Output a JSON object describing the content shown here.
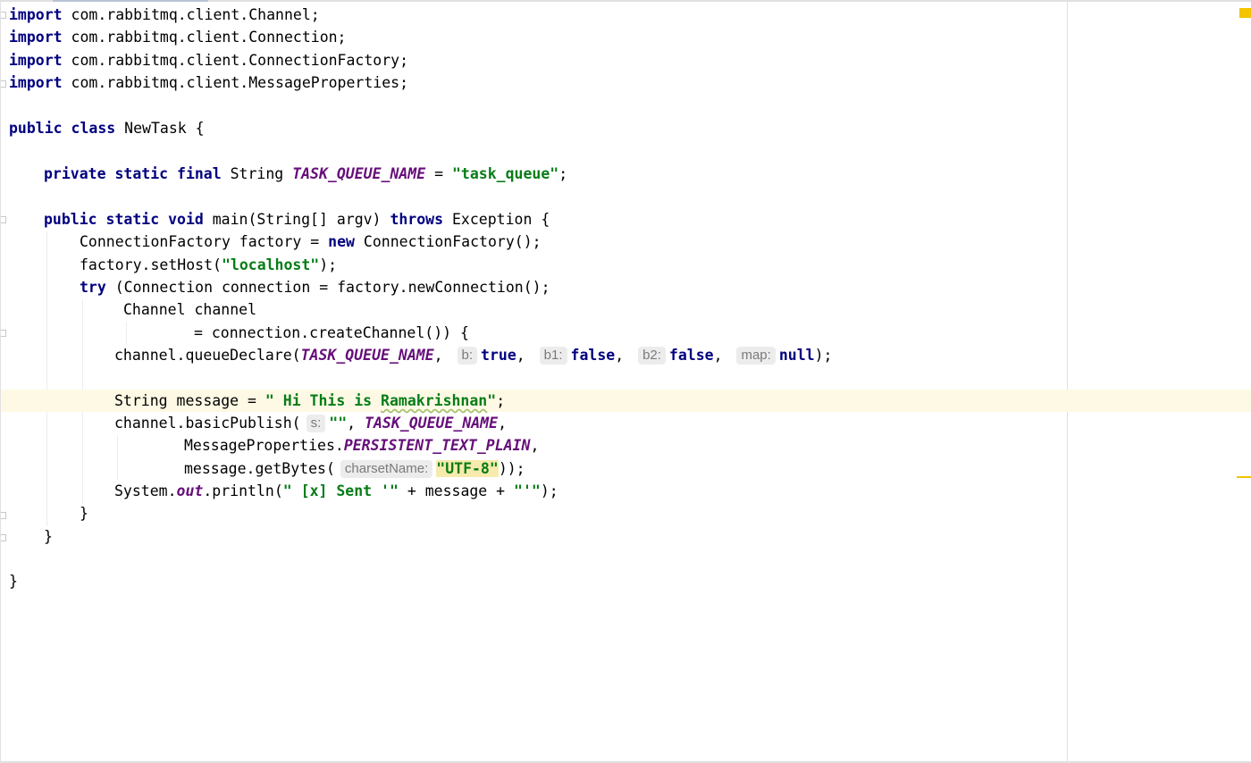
{
  "editor": {
    "language": "Java",
    "accent_colors": {
      "keyword": "#000080",
      "string": "#067d17",
      "constant": "#660e7a",
      "current_line": "#fdf9e5",
      "hint_background": "#ececec",
      "warning_stripe": "#f4c400"
    },
    "lines": {
      "l1": {
        "kw1": "import",
        "t1": " com.rabbitmq.client.Channel;"
      },
      "l2": {
        "kw1": "import",
        "t1": " com.rabbitmq.client.Connection;"
      },
      "l3": {
        "kw1": "import",
        "t1": " com.rabbitmq.client.ConnectionFactory;"
      },
      "l4": {
        "kw1": "import",
        "t1": " com.rabbitmq.client.MessageProperties;"
      },
      "l6": {
        "kw1": "public class",
        "t1": " NewTask {"
      },
      "l8": {
        "kw1": "private static final",
        "t1": " String ",
        "c1": "TASK_QUEUE_NAME",
        "t2": " = ",
        "s1": "\"task_queue\"",
        "t3": ";"
      },
      "l10": {
        "kw1": "public static void",
        "t1": " main(String[] argv) ",
        "kw2": "throws",
        "t2": " Exception {"
      },
      "l11": {
        "t1": "ConnectionFactory factory = ",
        "kw1": "new",
        "t2": " ConnectionFactory();"
      },
      "l12": {
        "t1": "factory.setHost(",
        "s1": "\"localhost\"",
        "t2": ");"
      },
      "l13": {
        "kw1": "try",
        "t1": " (Connection connection = factory.newConnection();"
      },
      "l14": {
        "t1": "Channel channel"
      },
      "l15": {
        "t1": "= connection.createChannel()) {"
      },
      "l16": {
        "t1": "channel.queueDeclare(",
        "c1": "TASK_QUEUE_NAME",
        "t2": ", ",
        "h1": "b:",
        "kw1": "true",
        "t3": ", ",
        "h2": "b1:",
        "kw2": "false",
        "t4": ", ",
        "h3": "b2:",
        "kw3": "false",
        "t5": ", ",
        "h4": "map:",
        "kw4": "null",
        "t6": ");"
      },
      "l18": {
        "t1": "String message = ",
        "s1": "\" Hi This is ",
        "s2": "Ramakrishnan",
        "s3": "\"",
        "t2": ";"
      },
      "l19": {
        "t1": "channel.basicPublish(",
        "h1": "s:",
        "s1": "\"\"",
        "t2": ", ",
        "c1": "TASK_QUEUE_NAME",
        "t3": ","
      },
      "l20": {
        "t1": "MessageProperties.",
        "c1": "PERSISTENT_TEXT_PLAIN",
        "t2": ","
      },
      "l21": {
        "t1": "message.getBytes(",
        "h1": "charsetName:",
        "s1": "\"UTF-8\"",
        "t2": "));"
      },
      "l22": {
        "t1": "System.",
        "c1": "out",
        "t2": ".println(",
        "s1": "\" [x] Sent '\"",
        "t3": " + message + ",
        "s2": "\"'\"",
        "t4": ");"
      },
      "l23": {
        "t1": "}"
      },
      "l24": {
        "t1": "}"
      },
      "l26": {
        "t1": "}"
      }
    }
  }
}
